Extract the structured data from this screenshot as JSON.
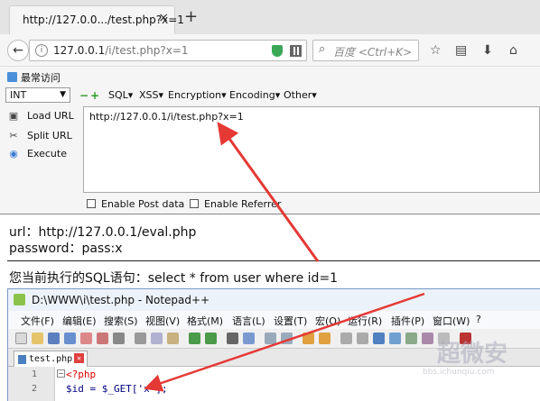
{
  "browser": {
    "tab_title": "http://127.0.0.../test.php?x=1",
    "tab_close": "×",
    "new_tab": "+",
    "url_host": "127.0.0.1",
    "url_path": "/i/test.php?x=1",
    "search_placeholder": "百度 <Ctrl+K>",
    "bookmark": "最常访问",
    "icons": [
      "back-icon",
      "info-icon",
      "shield-icon",
      "qr-icon",
      "search-icon",
      "star-icon",
      "reader-icon",
      "download-icon",
      "home-icon"
    ]
  },
  "hackbar": {
    "select_value": "INT",
    "menus": [
      "SQL",
      "XSS",
      "Encryption",
      "Encoding",
      "Other"
    ],
    "actions": [
      "Load URL",
      "Split URL",
      "Execute"
    ],
    "textarea": "http://127.0.0.1/i/test.php?x=1",
    "enable_post": "Enable Post data",
    "enable_referrer": "Enable Referrer"
  },
  "page": {
    "line1": "url：http://127.0.0.1/eval.php",
    "line2": "password：pass:x",
    "line3": "您当前执行的SQL语句：select * from user where id=1"
  },
  "notepad": {
    "title": "D:\\WWW\\i\\test.php - Notepad++",
    "menu": [
      "文件(F)",
      "编辑(E)",
      "搜索(S)",
      "视图(V)",
      "格式(M)",
      "语言(L)",
      "设置(T)",
      "宏(O)",
      "运行(R)",
      "插件(P)",
      "窗口(W)",
      "?"
    ],
    "tab": "test.php",
    "lines": [
      {
        "no": "1",
        "code": "<?php"
      },
      {
        "no": "2",
        "code": "$id = $_GET['x'];"
      }
    ]
  },
  "watermark": {
    "title": "超微安",
    "sub": "bbs.ichunqiu.com"
  },
  "colors": {
    "arrow": "#e53935",
    "php_tag": "#e00000",
    "variable": "#000080",
    "string": "#808080"
  }
}
